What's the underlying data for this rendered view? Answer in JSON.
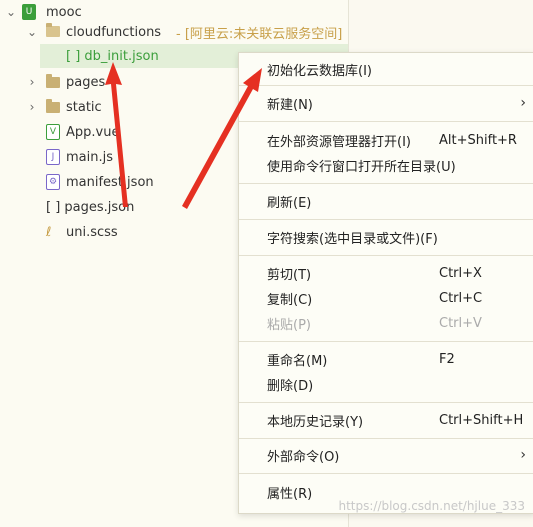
{
  "tree": {
    "root": {
      "label": "mooc"
    },
    "items": [
      {
        "label": "cloudfunctions",
        "hint": " - [阿里云:未关联云服务空间]"
      },
      {
        "label": "[ ] db_init.json"
      },
      {
        "label": "pages"
      },
      {
        "label": "static"
      },
      {
        "label": "App.vue"
      },
      {
        "label": "main.js"
      },
      {
        "label": "manifest.json"
      },
      {
        "label": "[ ] pages.json"
      },
      {
        "label": "uni.scss"
      }
    ]
  },
  "menu": {
    "items": [
      {
        "label": "初始化云数据库(I)",
        "key": ""
      },
      {
        "label": "新建(N)",
        "key": ""
      },
      {
        "label": "在外部资源管理器打开(I)",
        "key": "Alt+Shift+R"
      },
      {
        "label": "使用命令行窗口打开所在目录(U)",
        "key": ""
      },
      {
        "label": "刷新(E)",
        "key": ""
      },
      {
        "label": "字符搜索(选中目录或文件)(F)",
        "key": ""
      },
      {
        "label": "剪切(T)",
        "key": "Ctrl+X"
      },
      {
        "label": "复制(C)",
        "key": "Ctrl+C"
      },
      {
        "label": "粘贴(P)",
        "key": "Ctrl+V"
      },
      {
        "label": "重命名(M)",
        "key": "F2"
      },
      {
        "label": "删除(D)",
        "key": ""
      },
      {
        "label": "本地历史记录(Y)",
        "key": "Ctrl+Shift+H"
      },
      {
        "label": "外部命令(O)",
        "key": ""
      },
      {
        "label": "属性(R)",
        "key": ""
      }
    ]
  },
  "watermark": "https://blog.csdn.net/hjlue_333"
}
